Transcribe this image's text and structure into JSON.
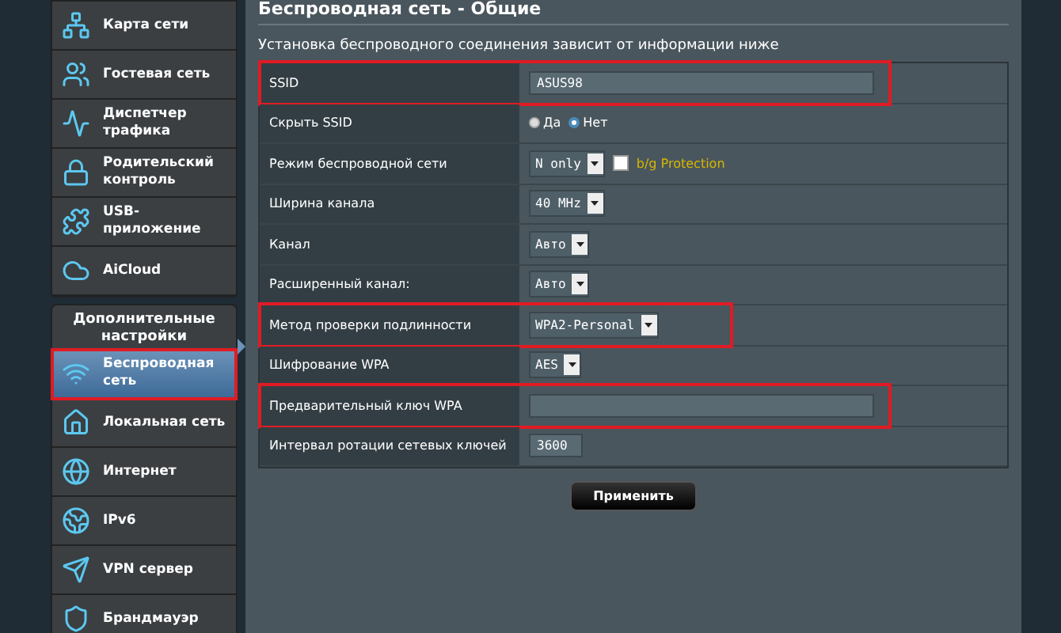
{
  "sidebar": {
    "items": [
      {
        "label": "Карта сети",
        "selected": false,
        "highlighted": false
      },
      {
        "label": "Гостевая сеть",
        "selected": false,
        "highlighted": false
      },
      {
        "label": "Диспетчер трафика",
        "selected": false,
        "highlighted": false
      },
      {
        "label": "Родительский контроль",
        "selected": false,
        "highlighted": false
      },
      {
        "label": "USB-приложение",
        "selected": false,
        "highlighted": false
      },
      {
        "label": "AiCloud",
        "selected": false,
        "highlighted": false
      }
    ],
    "section_title": "Дополнительные настройки",
    "advanced_items": [
      {
        "label": "Беспроводная сеть",
        "selected": true,
        "highlighted": true
      },
      {
        "label": "Локальная сеть",
        "selected": false,
        "highlighted": false
      },
      {
        "label": "Интернет",
        "selected": false,
        "highlighted": false
      },
      {
        "label": "IPv6",
        "selected": false,
        "highlighted": false
      },
      {
        "label": "VPN сервер",
        "selected": false,
        "highlighted": false
      },
      {
        "label": "Брандмауэр",
        "selected": false,
        "highlighted": false
      }
    ]
  },
  "page": {
    "title": "Беспроводная сеть - Общие",
    "description": "Установка беспроводного соединения зависит от информации ниже"
  },
  "settings": [
    {
      "label": "SSID",
      "kind": "text",
      "value": "ASUS98",
      "highlighted": true
    },
    {
      "label": "Скрыть SSID",
      "kind": "radio",
      "options": [
        {
          "label": "Да",
          "selected": false
        },
        {
          "label": "Нет",
          "selected": true
        }
      ],
      "highlighted": false
    },
    {
      "label": "Режим беспроводной сети",
      "kind": "select",
      "value": "N only",
      "checkbox": {
        "label": "b/g Protection",
        "checked": false
      },
      "highlighted": false
    },
    {
      "label": "Ширина канала",
      "kind": "select",
      "value": "40 MHz",
      "highlighted": false
    },
    {
      "label": "Канал",
      "kind": "select",
      "value": "Авто",
      "highlighted": false
    },
    {
      "label": "Расширенный канал:",
      "kind": "select",
      "value": "Авто",
      "highlighted": false
    },
    {
      "label": "Метод проверки подлинности",
      "kind": "select",
      "value": "WPA2-Personal",
      "highlighted": true
    },
    {
      "label": "Шифрование WPA",
      "kind": "select",
      "value": "AES",
      "highlighted": false
    },
    {
      "label": "Предварительный ключ WPA",
      "kind": "text",
      "highlighted": true
    },
    {
      "label": "Интервал ротации сетевых ключей",
      "kind": "short",
      "value": "3600",
      "highlighted": false
    }
  ],
  "apply_button": "Применить"
}
